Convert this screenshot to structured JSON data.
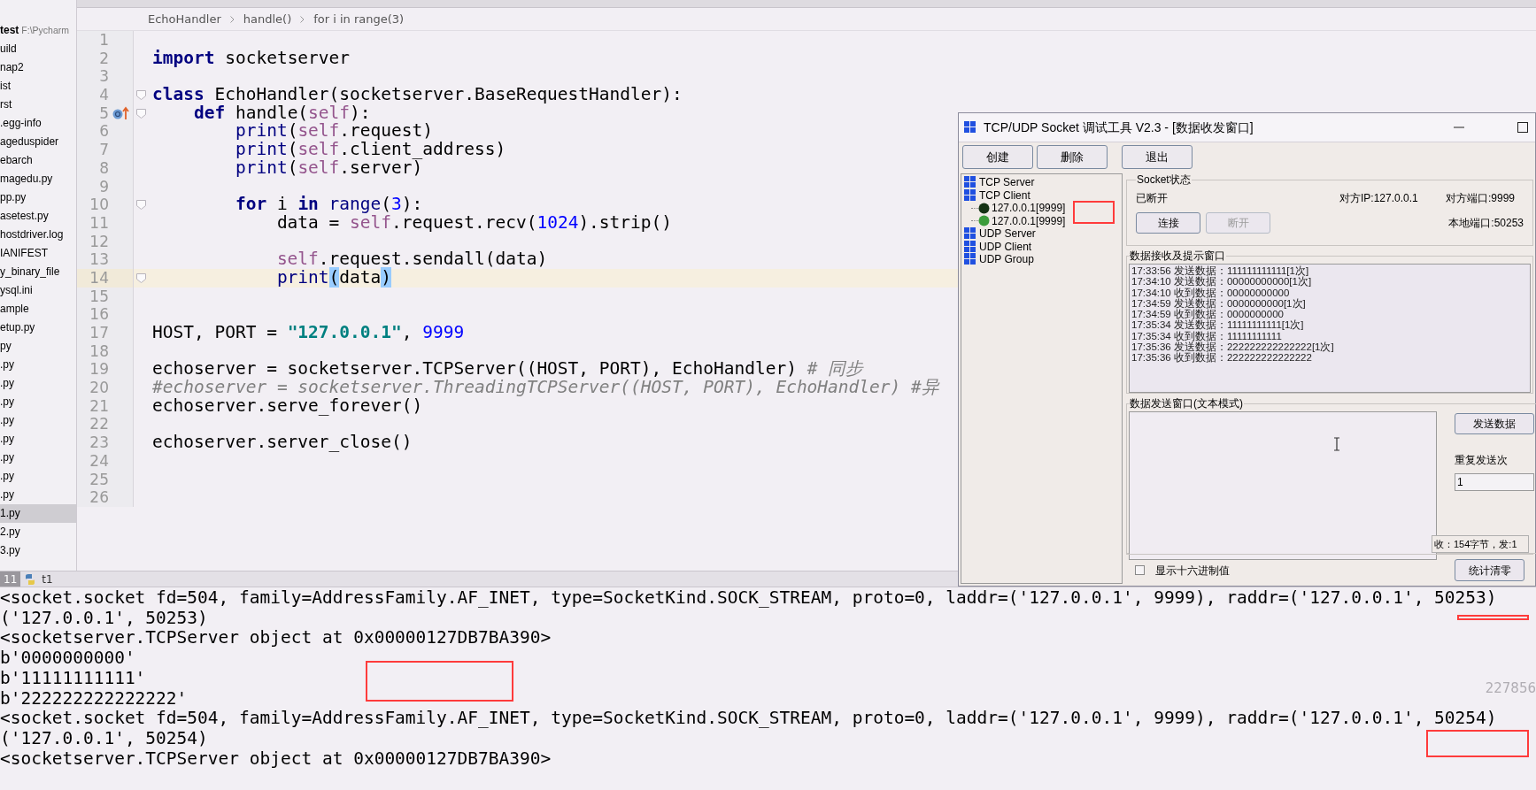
{
  "sidebar": {
    "root_name": "test",
    "root_path": "F:\\Pycharm",
    "items": [
      {
        "label": "uild",
        "selected": false
      },
      {
        "label": "nap2",
        "selected": false
      },
      {
        "label": "ist",
        "selected": false
      },
      {
        "label": "rst",
        "selected": false
      },
      {
        "label": ".egg-info",
        "selected": false
      },
      {
        "label": "ageduspider",
        "selected": false
      },
      {
        "label": "ebarch",
        "selected": false
      },
      {
        "label": "magedu.py",
        "selected": false
      },
      {
        "label": "pp.py",
        "selected": false
      },
      {
        "label": "asetest.py",
        "selected": false
      },
      {
        "label": "hostdriver.log",
        "selected": false
      },
      {
        "label": "IANIFEST",
        "selected": false
      },
      {
        "label": "y_binary_file",
        "selected": false
      },
      {
        "label": "ysql.ini",
        "selected": false
      },
      {
        "label": "ample",
        "selected": false
      },
      {
        "label": "etup.py",
        "selected": false
      },
      {
        "label": "py",
        "selected": false
      },
      {
        "label": ".py",
        "selected": false
      },
      {
        "label": ".py",
        "selected": false
      },
      {
        "label": ".py",
        "selected": false
      },
      {
        "label": ".py",
        "selected": false
      },
      {
        "label": ".py",
        "selected": false
      },
      {
        "label": ".py",
        "selected": false
      },
      {
        "label": ".py",
        "selected": false
      },
      {
        "label": ".py",
        "selected": false
      },
      {
        "label": "1.py",
        "selected": true
      },
      {
        "label": "2.py",
        "selected": false
      },
      {
        "label": "3.py",
        "selected": false
      }
    ]
  },
  "breadcrumb": [
    "EchoHandler",
    "handle()",
    "for i in range(3)"
  ],
  "code_lines": [
    {
      "number": "1",
      "current": false,
      "fold": false,
      "marker": false
    },
    {
      "number": "2",
      "current": false,
      "fold": false,
      "marker": false,
      "segments": [
        {
          "kind": "keyword",
          "text": "import"
        },
        {
          "kind": "plain",
          "text": " socketserver"
        }
      ]
    },
    {
      "number": "3",
      "current": false,
      "fold": false,
      "marker": false
    },
    {
      "number": "4",
      "current": false,
      "fold": true,
      "marker": false,
      "segments": [
        {
          "kind": "keyword",
          "text": "class"
        },
        {
          "kind": "plain",
          "text": " EchoHandler(socketserver.BaseRequestHandler):"
        }
      ]
    },
    {
      "number": "5",
      "current": false,
      "fold": true,
      "marker": true,
      "segments": [
        {
          "kind": "keyword",
          "text": "    def"
        },
        {
          "kind": "plain",
          "text": " handle("
        },
        {
          "kind": "self",
          "text": "self"
        },
        {
          "kind": "plain",
          "text": "):"
        }
      ]
    },
    {
      "number": "6",
      "current": false,
      "fold": false,
      "marker": false,
      "segments": [
        {
          "kind": "builtin",
          "text": "        print"
        },
        {
          "kind": "plain",
          "text": "("
        },
        {
          "kind": "self",
          "text": "self"
        },
        {
          "kind": "plain",
          "text": ".request)"
        }
      ]
    },
    {
      "number": "7",
      "current": false,
      "fold": false,
      "marker": false,
      "segments": [
        {
          "kind": "builtin",
          "text": "        print"
        },
        {
          "kind": "plain",
          "text": "("
        },
        {
          "kind": "self",
          "text": "self"
        },
        {
          "kind": "plain",
          "text": ".client_address)"
        }
      ]
    },
    {
      "number": "8",
      "current": false,
      "fold": false,
      "marker": false,
      "segments": [
        {
          "kind": "builtin",
          "text": "        print"
        },
        {
          "kind": "plain",
          "text": "("
        },
        {
          "kind": "self",
          "text": "self"
        },
        {
          "kind": "plain",
          "text": ".server)"
        }
      ]
    },
    {
      "number": "9",
      "current": false,
      "fold": false,
      "marker": false
    },
    {
      "number": "10",
      "current": false,
      "fold": true,
      "marker": false,
      "segments": [
        {
          "kind": "keyword",
          "text": "        for"
        },
        {
          "kind": "plain",
          "text": " i "
        },
        {
          "kind": "keyword",
          "text": "in"
        },
        {
          "kind": "builtin",
          "text": " range"
        },
        {
          "kind": "plain",
          "text": "("
        },
        {
          "kind": "number",
          "text": "3"
        },
        {
          "kind": "plain",
          "text": "):"
        }
      ]
    },
    {
      "number": "11",
      "current": false,
      "fold": false,
      "marker": false,
      "segments": [
        {
          "kind": "plain",
          "text": "            data = "
        },
        {
          "kind": "self",
          "text": "self"
        },
        {
          "kind": "plain",
          "text": ".request.recv("
        },
        {
          "kind": "number",
          "text": "1024"
        },
        {
          "kind": "plain",
          "text": ").strip()"
        }
      ]
    },
    {
      "number": "12",
      "current": false,
      "fold": false,
      "marker": false
    },
    {
      "number": "13",
      "current": false,
      "fold": false,
      "marker": false,
      "segments": [
        {
          "kind": "self",
          "text": "            self"
        },
        {
          "kind": "plain",
          "text": ".request.sendall(data)"
        }
      ]
    },
    {
      "number": "14",
      "current": true,
      "fold": true,
      "marker": false,
      "segments": [
        {
          "kind": "builtin",
          "text": "            print"
        },
        {
          "kind": "brace",
          "text": "("
        },
        {
          "kind": "plain",
          "text": "data"
        },
        {
          "kind": "brace",
          "text": ")"
        }
      ]
    },
    {
      "number": "15",
      "current": false,
      "fold": false,
      "marker": false
    },
    {
      "number": "16",
      "current": false,
      "fold": false,
      "marker": false
    },
    {
      "number": "17",
      "current": false,
      "fold": false,
      "marker": false,
      "segments": [
        {
          "kind": "plain",
          "text": "HOST, PORT = "
        },
        {
          "kind": "string",
          "text": "\"127.0.0.1\""
        },
        {
          "kind": "plain",
          "text": ", "
        },
        {
          "kind": "number",
          "text": "9999"
        }
      ]
    },
    {
      "number": "18",
      "current": false,
      "fold": false,
      "marker": false
    },
    {
      "number": "19",
      "current": false,
      "fold": false,
      "marker": false,
      "segments": [
        {
          "kind": "plain",
          "text": "echoserver = socketserver.TCPServer((HOST, PORT), EchoHandler) "
        },
        {
          "kind": "comment",
          "text": "# 同步"
        }
      ]
    },
    {
      "number": "20",
      "current": false,
      "fold": false,
      "marker": false,
      "segments": [
        {
          "kind": "comment",
          "text": "#echoserver = socketserver.ThreadingTCPServer((HOST, PORT), EchoHandler) #异"
        }
      ]
    },
    {
      "number": "21",
      "current": false,
      "fold": false,
      "marker": false,
      "segments": [
        {
          "kind": "plain",
          "text": "echoserver.serve_forever()"
        }
      ]
    },
    {
      "number": "22",
      "current": false,
      "fold": false,
      "marker": false
    },
    {
      "number": "23",
      "current": false,
      "fold": false,
      "marker": false,
      "segments": [
        {
          "kind": "plain",
          "text": "echoserver.server_close()"
        }
      ]
    },
    {
      "number": "24",
      "current": false,
      "fold": false,
      "marker": false
    },
    {
      "number": "25",
      "current": false,
      "fold": false,
      "marker": false
    },
    {
      "number": "26",
      "current": false,
      "fold": false,
      "marker": false
    }
  ],
  "run_tabs": [
    {
      "label": "11",
      "selected": true,
      "kind": "plain"
    },
    {
      "label": "t1",
      "selected": false,
      "kind": "python"
    }
  ],
  "console": [
    "<socket.socket fd=504, family=AddressFamily.AF_INET, type=SocketKind.SOCK_STREAM, proto=0, laddr=('127.0.0.1', 9999), raddr=('127.0.0.1', 50253)",
    "('127.0.0.1', 50253)",
    "<socketserver.TCPServer object at 0x00000127DB7BA390>",
    "b'0000000000'",
    "b'11111111111'",
    "b'222222222222222'",
    "<socket.socket fd=504, family=AddressFamily.AF_INET, type=SocketKind.SOCK_STREAM, proto=0, laddr=('127.0.0.1', 9999), raddr=('127.0.0.1', 50254)",
    "('127.0.0.1', 50254)",
    "<socketserver.TCPServer object at 0x00000127DB7BA390>"
  ],
  "overlay_text": "227856",
  "socket_tool": {
    "title": "TCP/UDP Socket 调试工具 V2.3 - [数据收发窗口]",
    "toolbar": [
      "创建",
      "删除",
      "退出"
    ],
    "tree": [
      {
        "label": "TCP Server"
      },
      {
        "label": "TCP Client",
        "children": [
          {
            "label": "127.0.0.1[9999]",
            "color": "#143214"
          },
          {
            "label": "127.0.0.1[9999]",
            "color": "#3c9c3c"
          }
        ]
      },
      {
        "label": "UDP Server"
      },
      {
        "label": "UDP Client"
      },
      {
        "label": "UDP Group"
      }
    ],
    "status": {
      "title": "Socket状态",
      "state": "已断开",
      "remote_ip": "对方IP:127.0.0.1",
      "remote_port": "对方端口:9999",
      "local_port": "本地端口:50253",
      "buttons": [
        {
          "label": "连接",
          "disabled": false
        },
        {
          "label": "断开",
          "disabled": true
        }
      ]
    },
    "receive": {
      "title": "数据接收及提示窗口",
      "lines": [
        "17:33:56 发送数据：111111111111[1次]",
        "17:34:10 发送数据：00000000000[1次]",
        "17:34:10 收到数据：00000000000",
        "17:34:59 发送数据：0000000000[1次]",
        "17:34:59 收到数据：0000000000",
        "17:35:34 发送数据：11111111111[1次]",
        "17:35:34 收到数据：11111111111",
        "17:35:36 发送数据：222222222222222[1次]",
        "17:35:36 收到数据：222222222222222"
      ]
    },
    "send": {
      "title": "数据发送窗口(文本模式)",
      "send_button": "发送数据",
      "repeat_label": "重复发送次",
      "repeat_value": "1",
      "counter": "收：154字节，发:1"
    },
    "hex_option": {
      "label": "显示十六进制值",
      "checked": false
    },
    "reset_button": "统计清零"
  }
}
